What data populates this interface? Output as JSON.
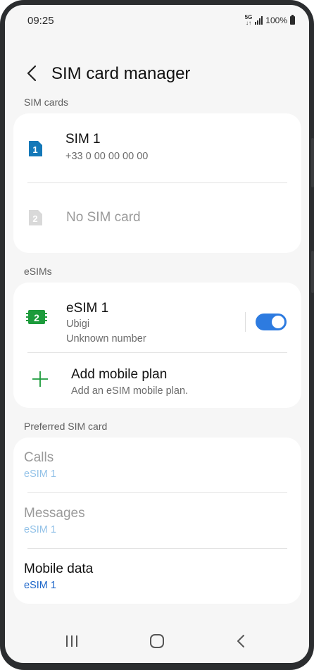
{
  "status_bar": {
    "time": "09:25",
    "network_top": "5G",
    "network_bottom": "↓↑",
    "battery": "100%"
  },
  "header": {
    "title": "SIM card manager",
    "back_icon": "chevron-left-icon"
  },
  "sim_cards": {
    "section_label": "SIM cards",
    "items": [
      {
        "badge": "1",
        "name": "SIM 1",
        "number": "+33 0 00 00 00 00",
        "icon": "sim-card-icon",
        "color": "#1478b8"
      },
      {
        "badge": "2",
        "name": "No SIM card",
        "icon": "sim-card-icon",
        "color": "#d9d9d9"
      }
    ]
  },
  "esims": {
    "section_label": "eSIMs",
    "items": [
      {
        "badge": "2",
        "name": "eSIM 1",
        "carrier": "Ubigi",
        "number": "Unknown number",
        "enabled": true,
        "icon": "esim-chip-icon",
        "color": "#1c9b3b"
      }
    ],
    "add_plan": {
      "title": "Add mobile plan",
      "subtitle": "Add an eSIM mobile plan.",
      "icon": "plus-icon",
      "color": "#1c9b3b"
    }
  },
  "preferred": {
    "section_label": "Preferred SIM card",
    "items": [
      {
        "label": "Calls",
        "value": "eSIM 1",
        "enabled": false
      },
      {
        "label": "Messages",
        "value": "eSIM 1",
        "enabled": false
      },
      {
        "label": "Mobile data",
        "value": "eSIM 1",
        "enabled": true
      }
    ]
  },
  "colors": {
    "accent": "#2d7be0",
    "link_value": "#1d66c9",
    "link_value_disabled": "#93c2e8"
  },
  "nav_bar": {
    "recents_icon": "recent-apps-icon",
    "home_icon": "home-icon",
    "back_icon": "back-icon"
  }
}
